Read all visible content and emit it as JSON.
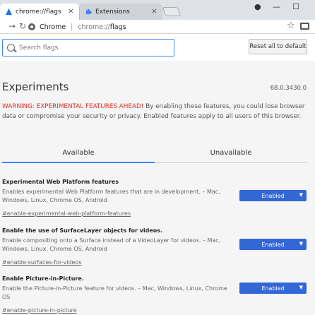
{
  "browser": {
    "tabs": [
      {
        "title": "chrome://flags",
        "active": true
      },
      {
        "title": "Extensions",
        "active": false
      }
    ],
    "omnibox": {
      "scheme": "Chrome",
      "host": "chrome://",
      "path": "flags"
    }
  },
  "header": {
    "search_placeholder": "Search flags",
    "reset_label": "Reset all to default"
  },
  "main": {
    "title": "Experiments",
    "version": "68.0.3430.0",
    "warning_strong": "WARNING: EXPERIMENTAL FEATURES AHEAD!",
    "warning_text": " By enabling these features, you could lose browser data or compromise your security or privacy. Enabled features apply to all users of this browser.",
    "tabs": [
      {
        "label": "Available",
        "selected": true
      },
      {
        "label": "Unavailable",
        "selected": false
      }
    ],
    "flags": [
      {
        "name": "Experimental Web Platform features",
        "description": "Enables experimental Web Platform features that are in development. – Mac, Windows, Linux, Chrome OS, Android",
        "link": "#enable-experimental-web-platform-features",
        "value": "Enabled"
      },
      {
        "name": "Enable the use of SurfaceLayer objects for videos.",
        "description": "Enable compositing onto a Surface instead of a VideoLayer for videos. – Mac, Windows, Linux, Chrome OS, Android",
        "link": "#enable-surfaces-for-videos",
        "value": "Enabled"
      },
      {
        "name": "Enable Picture-in-Picture.",
        "description": "Enable the Picture-in-Picture feature for videos. – Mac, Windows, Linux, Chrome OS",
        "link": "#enable-picture-in-picture",
        "value": "Enabled"
      }
    ]
  },
  "colors": {
    "accent": "#4285f4",
    "select_bg": "#3367d6",
    "warning": "#d93025"
  }
}
